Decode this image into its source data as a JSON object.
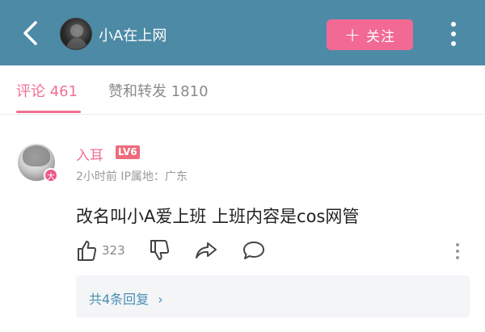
{
  "header": {
    "title": "小A在上网",
    "follow_label": "关注",
    "follow_plus": "+"
  },
  "tabs": [
    {
      "label": "评论 461",
      "active": true
    },
    {
      "label": "赞和转发 1810",
      "active": false
    }
  ],
  "comment": {
    "username": "入耳",
    "level": "LV6",
    "vip_badge": "大",
    "meta": "2小时前 IP属地：广东",
    "text": "改名叫小A爱上班 上班内容是cos网管",
    "like_count": "323",
    "replies_label": "共4条回复",
    "replies_chevron": "›"
  },
  "colors": {
    "header_bg": "#4d8aa5",
    "accent_pink": "#f07092",
    "follow_bg": "#f26a94",
    "level_badge": "#ef6b7b",
    "link_blue": "#4a8fb2"
  },
  "icons": [
    "back-arrow-icon",
    "more-vertical-icon",
    "thumbs-up-icon",
    "thumbs-down-icon",
    "share-icon",
    "comment-bubble-icon"
  ]
}
